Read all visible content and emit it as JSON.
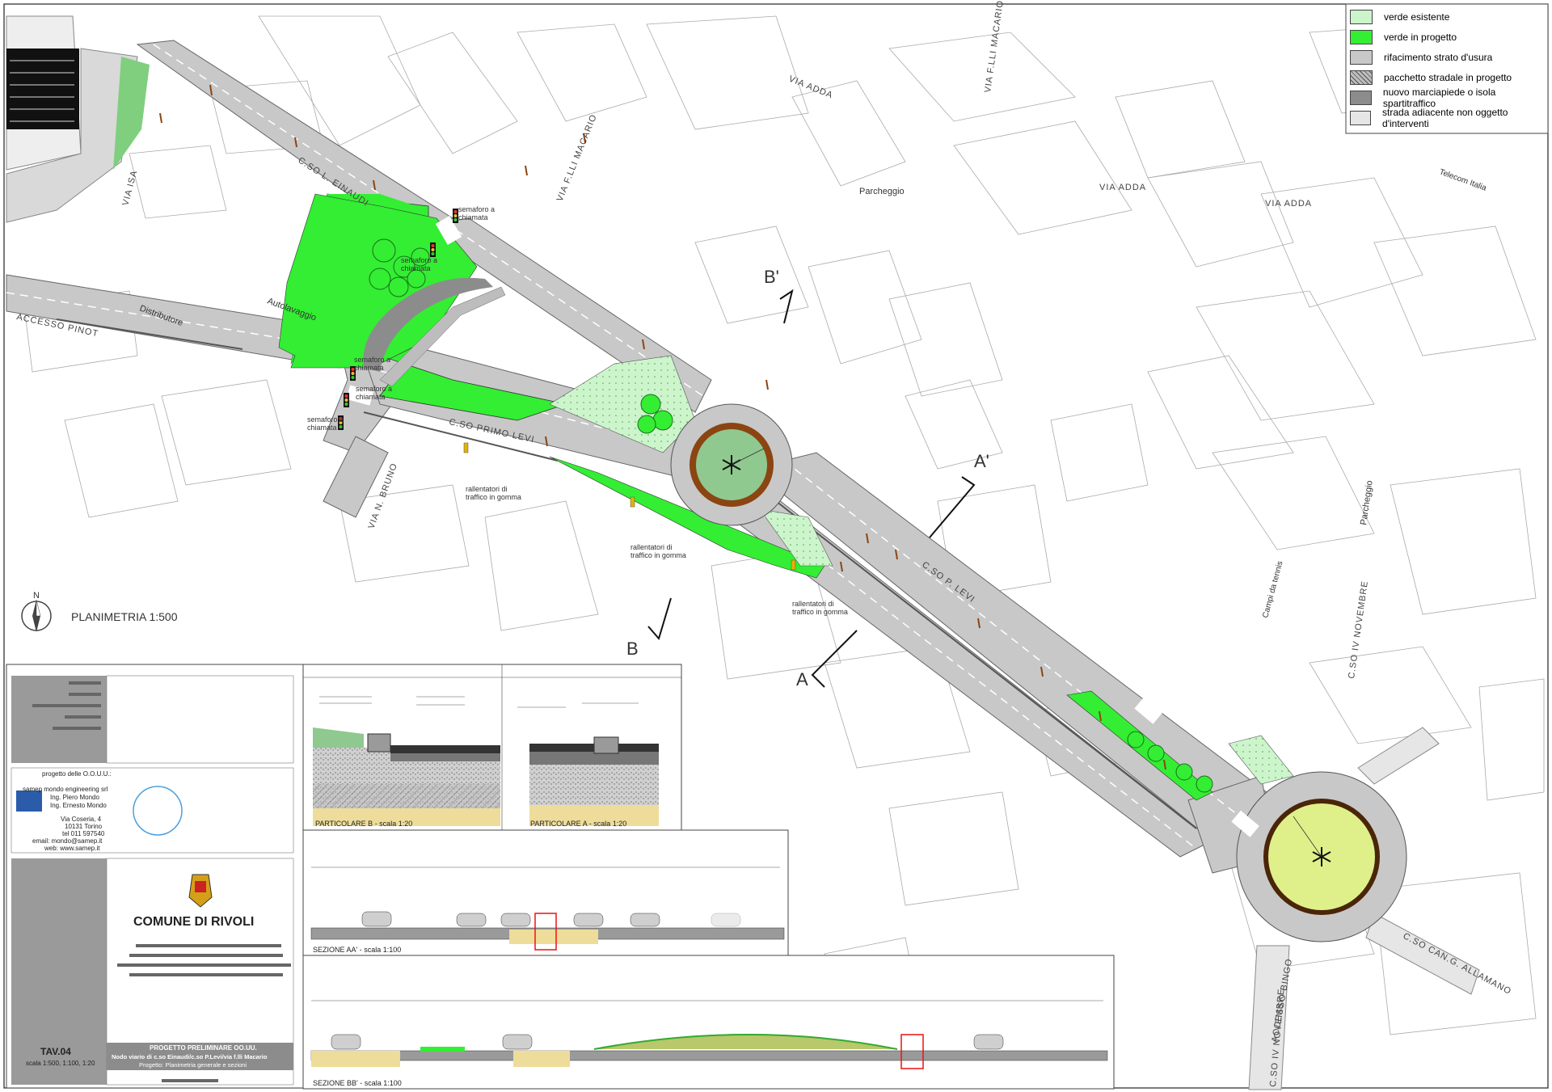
{
  "legend": [
    {
      "label": "verde esistente",
      "swatch": "#ccf5cc"
    },
    {
      "label": "verde in progetto",
      "swatch": "#33ee33"
    },
    {
      "label": "rifacimento strato d'usura",
      "swatch": "#c8c8c8"
    },
    {
      "label": "pacchetto stradale in progetto",
      "swatch": "hatch"
    },
    {
      "label": "nuovo marciapiede o isola spartitraffico",
      "swatch": "#8c8c8c"
    },
    {
      "label": "strada adiacente non oggetto d'interventi",
      "swatch": "#e6e6e6"
    }
  ],
  "streets": {
    "via_adda_1": "VIA ADDA",
    "via_adda_2": "VIA ADDA",
    "via_adda_3": "VIA ADDA",
    "via_macario_top": "VIA F.LLI MACARIO",
    "via_macario": "VIA F.LLI MACARIO",
    "cso_einaudi": "C.SO L. EINAUDI",
    "via_isa": "VIA ISA",
    "accesso_pinot": "ACCESSO PINOT",
    "cso_primo_levi": "C.SO PRIMO LEVI",
    "via_bruno": "VIA N. BRUNO",
    "cso_levi_se": "C.SO P. LEVI",
    "cso_iv_novembre": "C.SO IV NOVEMBRE",
    "cso_allamano": "C.SO CAN.G. ALLAMANO",
    "accesso_bingo": "ACCESSO BINGO",
    "cso_iv_novembre_bottom": "C.SO IV NOVEMBRE"
  },
  "places": {
    "parcheggio_1": "Parcheggio",
    "parcheggio_2": "Parcheggio",
    "distributore": "Distributore",
    "autolavaggio": "Autolavaggio",
    "telecom": "Telecom Italia",
    "campi_tennis": "Campi da tennis"
  },
  "annotations": {
    "sem1_a": "semaforo a",
    "sem1_b": "chiamata",
    "sem2_a": "semaforo a",
    "sem2_b": "chiamata",
    "sem3_a": "semaforo a",
    "sem3_b": "chiamata",
    "sem4_a": "semaforo a",
    "sem4_b": "chiamata",
    "sem5_a": "semaforo a",
    "sem5_b": "chiamata",
    "ral1_a": "rallentatori di",
    "ral1_b": "traffico in gomma",
    "ral2_a": "rallentatori di",
    "ral2_b": "traffico in gomma",
    "ral3_a": "rallentatori di",
    "ral3_b": "traffico in gomma"
  },
  "section_marks": {
    "a": "A",
    "a_prime": "A'",
    "b": "B",
    "b_prime": "B'"
  },
  "plan_title": "PLANIMETRIA 1:500",
  "north": "N",
  "details": {
    "part_b": "PARTICOLARE B - scala 1:20",
    "part_a": "PARTICOLARE A - scala 1:20",
    "sez_aa": "SEZIONE AA' - scala 1:100",
    "sez_bb": "SEZIONE BB' - scala 1:100"
  },
  "title_block": {
    "designer_heading": "progetto delle O.O.U.U.:",
    "firm": "samep mondo engineering srl",
    "eng1": "Ing. Piero Mondo",
    "eng2": "Ing. Ernesto Mondo",
    "address": "Via Coseria, 4",
    "city": "10131 Torino",
    "tel": "tel 011 597540",
    "email": "email: mondo@samep.it",
    "web": "web: www.samep.it",
    "comune": "COMUNE DI RIVOLI",
    "tav": "TAV.04",
    "scale": "scala 1:500, 1:100, 1:20",
    "proj1": "PROGETTO PRELIMINARE OO.UU.",
    "proj2": "Nodo viario di c.so Einaudi/c.so P.Levi/via f.lli Macario",
    "proj3": "Progetto: Planimetria generale e sezioni"
  },
  "colors": {
    "verde_progetto": "#33ee33",
    "verde_esistente": "#ccf5cc",
    "asphalt": "#c8c8c8",
    "sidewalk": "#8c8c8c",
    "roundabout_ring": "#8b4513",
    "roundabout_inner": "#dff08a"
  }
}
